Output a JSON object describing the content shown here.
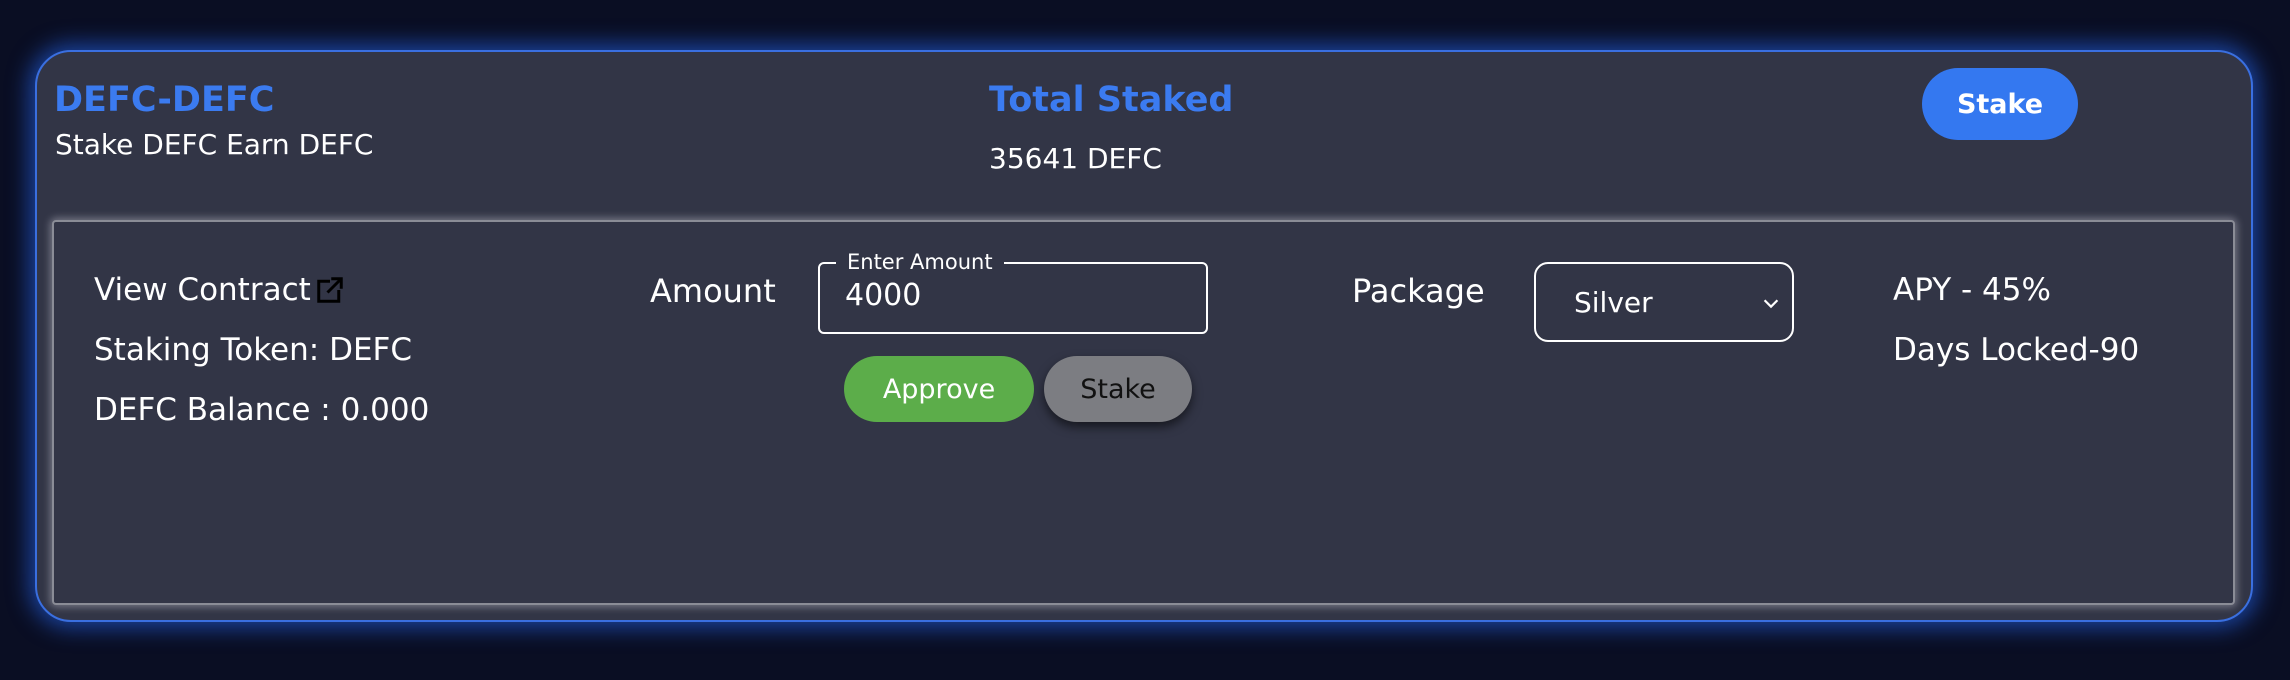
{
  "pool": {
    "title": "DEFC-DEFC",
    "subtitle": "Stake DEFC Earn DEFC"
  },
  "total_staked": {
    "label": "Total Staked",
    "value": "35641 DEFC"
  },
  "header": {
    "stake_button_label": "Stake"
  },
  "details": {
    "view_contract_label": "View Contract",
    "view_contract_icon": "external-link-icon",
    "staking_token": "Staking Token: DEFC",
    "balance": "DEFC Balance : 0.000"
  },
  "amount": {
    "label": "Amount",
    "field_legend": "Enter Amount",
    "value": "4000",
    "approve_label": "Approve",
    "stake_label": "Stake"
  },
  "package": {
    "label": "Package",
    "selected": "Silver",
    "dropdown_icon": "chevron-down-icon"
  },
  "terms": {
    "apy": "APY - 45%",
    "days_locked": "Days Locked-90"
  },
  "colors": {
    "page_background": "#0a0e23",
    "card_background": "#323546",
    "accent_blue": "#3b7bf0",
    "approve_green": "#5cad4a",
    "disabled_gray": "#7c7d82"
  }
}
